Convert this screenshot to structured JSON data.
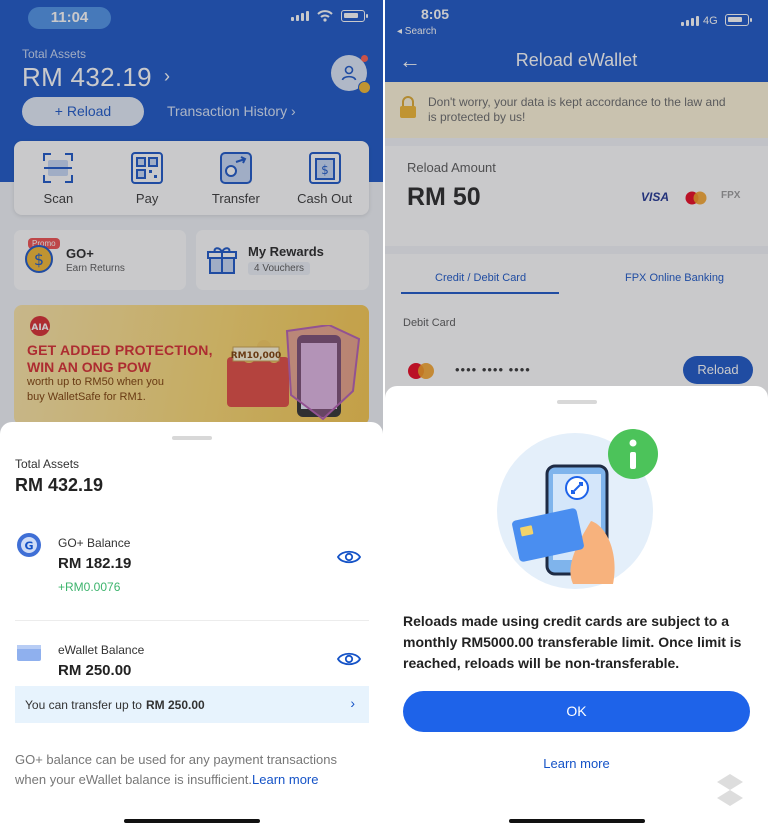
{
  "left": {
    "status_time": "11:04",
    "total_assets_label": "Total Assets",
    "total_assets_value": "RM 432.19",
    "reload_label": "+ Reload",
    "transaction_history_label": "Transaction History",
    "actions": [
      {
        "label": "Scan",
        "icon": "scan-icon"
      },
      {
        "label": "Pay",
        "icon": "qr-pay-icon"
      },
      {
        "label": "Transfer",
        "icon": "transfer-icon"
      },
      {
        "label": "Cash Out",
        "icon": "cash-out-icon"
      }
    ],
    "promo_tag": "Promo",
    "goplus_title": "GO+",
    "goplus_sub": "Earn Returns",
    "rewards_title": "My Rewards",
    "rewards_sub": "4 Vouchers",
    "banner": {
      "line1": "GET ADDED PROTECTION,",
      "line2": "WIN AN ONG POW",
      "line3": "worth up to RM50 when you",
      "line4": "buy WalletSafe for RM1.",
      "amount_tag": "RM10,000"
    },
    "sheet": {
      "total_label": "Total Assets",
      "total_value": "RM 432.19",
      "goplus_label": "GO+ Balance",
      "goplus_value": "RM 182.19",
      "goplus_delta": "+RM0.0076",
      "ewallet_label": "eWallet Balance",
      "ewallet_value": "RM 250.00",
      "transfer_text": "You can transfer up to",
      "transfer_amount": "RM 250.00",
      "note_text": "GO+ balance can be used for any payment transactions when your eWallet balance is insufficient.",
      "note_link": "Learn more"
    }
  },
  "right": {
    "status_time": "8:05",
    "back_label": "◂ Search",
    "network": "4G",
    "title": "Reload eWallet",
    "notice": "Don't worry, your data is kept accordance to the law and is protected by us!",
    "amount_label": "Reload Amount",
    "amount_value": "RM 50",
    "visa": "VISA",
    "fpx": "FPX",
    "tabs": [
      "Credit / Debit Card",
      "FPX Online Banking"
    ],
    "debit_label": "Debit Card",
    "card_number": "•••• •••• ••••",
    "reload_button": "Reload",
    "sheet": {
      "message": "Reloads made using credit cards are subject to a monthly RM5000.00 transferable limit. Once limit is reached, reloads will be non-transferable.",
      "ok_label": "OK",
      "learn_more": "Learn more"
    }
  },
  "colors": {
    "brand_blue": "#1553c7",
    "accent_green": "#3db46d",
    "info_green": "#4cc35a"
  }
}
